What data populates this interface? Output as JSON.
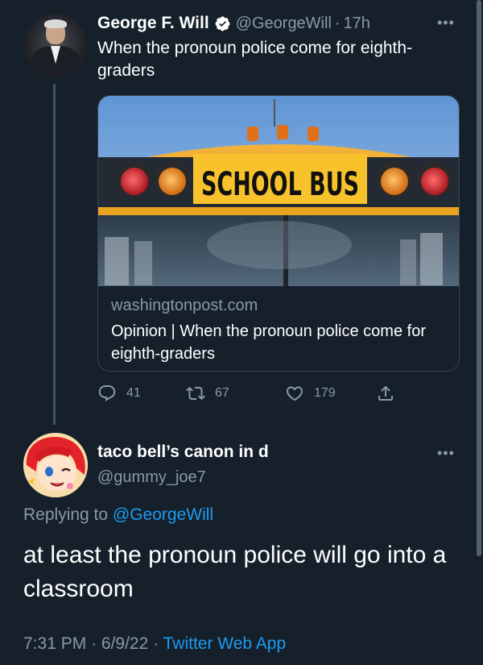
{
  "tweet": {
    "display_name": "George F. Will",
    "handle": "@GeorgeWill",
    "separator": "·",
    "time": "17h",
    "text": "When the pronoun police come for eighth-graders",
    "card": {
      "sign_text": "SCHOOL BUS",
      "domain": "washingtonpost.com",
      "title": "Opinion | When the pronoun police come for eighth-graders"
    },
    "actions": {
      "replies": "41",
      "retweets": "67",
      "likes": "179"
    }
  },
  "reply": {
    "display_name": "taco bell’s canon in d",
    "handle": "@gummy_joe7",
    "replying_prefix": "Replying to ",
    "replying_to": "@GeorgeWill",
    "text": "at least the pronoun police will go into a classroom",
    "time": "7:31 PM",
    "separator_1": "·",
    "date": "6/9/22",
    "separator_2": "·",
    "source": "Twitter Web App"
  },
  "more_label": "•••",
  "colors": {
    "background": "#15202b",
    "secondary_text": "#8b98a5",
    "link": "#1d9bf0",
    "border": "#38444d"
  },
  "icons": [
    "verified-badge-icon",
    "reply-icon",
    "retweet-icon",
    "like-icon",
    "share-icon",
    "more-icon"
  ]
}
